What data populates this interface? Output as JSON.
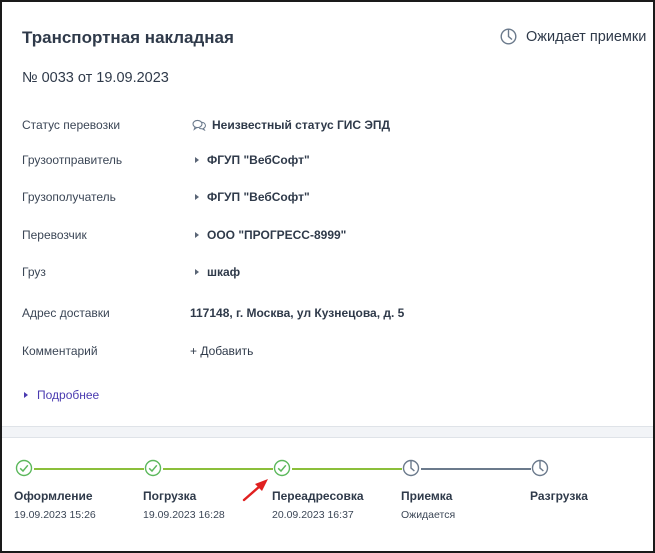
{
  "document": {
    "title": "Транспортная накладная",
    "status": "Ожидает приемки",
    "number": "№ 0033 от 19.09.2023"
  },
  "fields": [
    {
      "label": "Статус перевозки",
      "value": "Неизвестный статус ГИС ЭПД",
      "icon": "chat-bubbles-icon"
    },
    {
      "label": "Грузоотправитель",
      "value": "ФГУП \"ВебСофт\"",
      "icon": "expand-triangle-icon"
    },
    {
      "label": "Грузополучатель",
      "value": "ФГУП \"ВебСофт\"",
      "icon": "expand-triangle-icon"
    },
    {
      "label": "Перевозчик",
      "value": "ООО \"ПРОГРЕСС-8999\"",
      "icon": "expand-triangle-icon"
    },
    {
      "label": "Груз",
      "value": "шкаф",
      "icon": "expand-triangle-icon"
    },
    {
      "label": "Адрес доставки",
      "value": "117148, г. Москва, ул Кузнецова, д. 5",
      "icon": ""
    },
    {
      "label": "Комментарий",
      "value": "+ Добавить",
      "icon": ""
    }
  ],
  "more_link": "Подробнее",
  "timeline": [
    {
      "name": "Оформление",
      "date": "19.09.2023 15:26",
      "state": "done"
    },
    {
      "name": "Погрузка",
      "date": "19.09.2023 16:28",
      "state": "done"
    },
    {
      "name": "Переадресовка",
      "date": "20.09.2023 16:37",
      "state": "done"
    },
    {
      "name": "Приемка",
      "date": "Ожидается",
      "state": "pending"
    },
    {
      "name": "Разгрузка",
      "date": "",
      "state": "pending"
    }
  ],
  "colors": {
    "done": "#5cb85c",
    "done_line": "#8bbf3a",
    "pending": "#6b7a8c",
    "pending_line": "#6b7a8c",
    "link": "#5b3fc4",
    "arrow": "#e02020"
  }
}
